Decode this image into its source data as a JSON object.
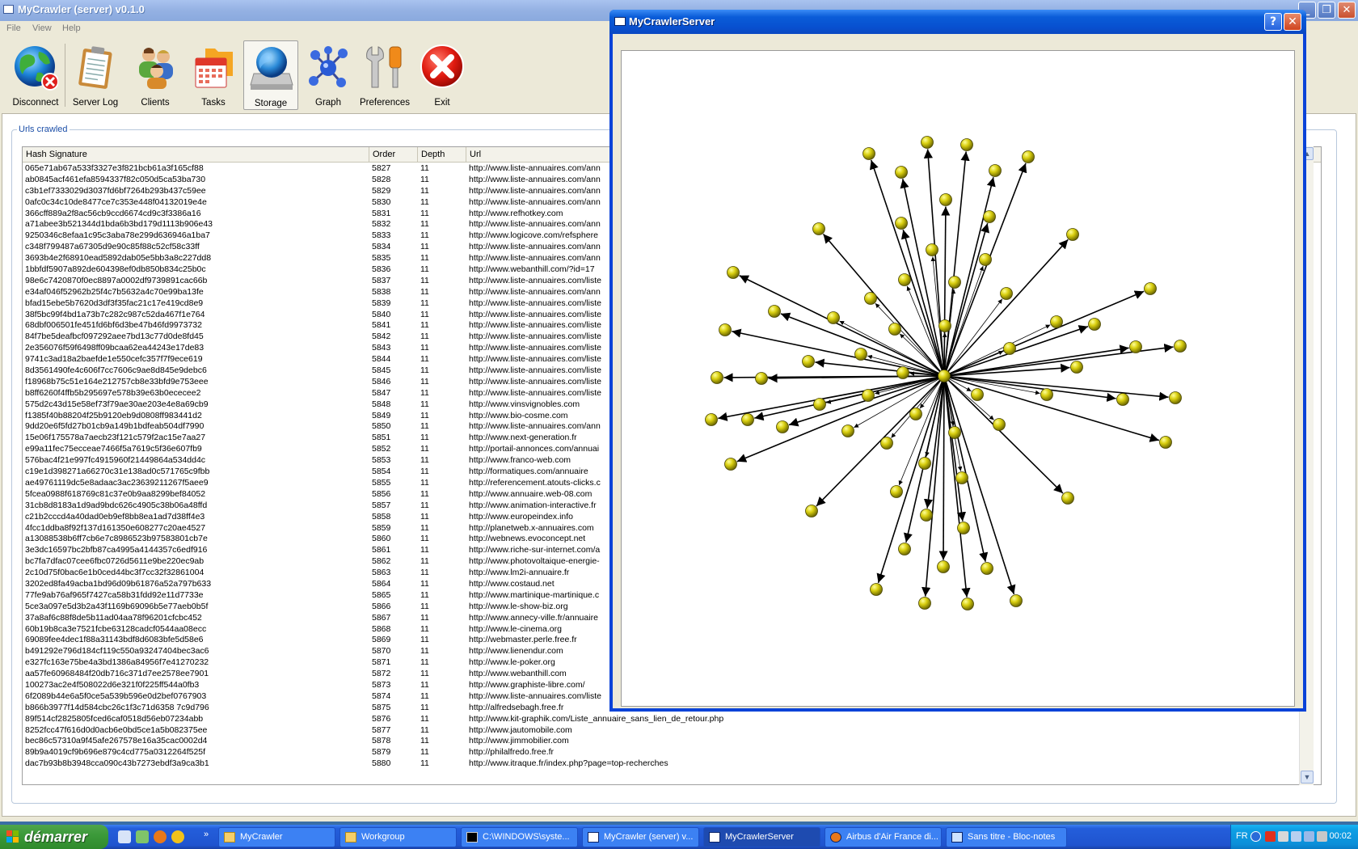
{
  "main_window": {
    "title": "MyCrawler (server) v0.1.0",
    "menu": [
      "File",
      "View",
      "Help"
    ],
    "toolbar": [
      {
        "label": "Disconnect",
        "icon": "globe-disconnect-icon"
      },
      {
        "label": "Server Log",
        "icon": "clipboard-icon"
      },
      {
        "label": "Clients",
        "icon": "users-icon"
      },
      {
        "label": "Tasks",
        "icon": "calendar-folder-icon"
      },
      {
        "label": "Storage",
        "icon": "storage-globe-icon",
        "active": true
      },
      {
        "label": "Graph",
        "icon": "molecule-graph-icon"
      },
      {
        "label": "Preferences",
        "icon": "wrench-icon"
      },
      {
        "label": "Exit",
        "icon": "exit-x-icon"
      }
    ],
    "group_title": "Urls crawled",
    "columns": [
      "Hash Signature",
      "Order",
      "Depth",
      "Url"
    ],
    "rows": [
      [
        "065e71ab67a533f3327e3f821bcb61a3f165cf88",
        "5827",
        "11",
        "http://www.liste-annuaires.com/ann"
      ],
      [
        "ab0845acf461efa8594337f82c050d5ca53ba730",
        "5828",
        "11",
        "http://www.liste-annuaires.com/ann"
      ],
      [
        "c3b1ef7333029d3037fd6bf7264b293b437c59ee",
        "5829",
        "11",
        "http://www.liste-annuaires.com/ann"
      ],
      [
        "0afc0c34c10de8477ce7c353e448f04132019e4e",
        "5830",
        "11",
        "http://www.liste-annuaires.com/ann"
      ],
      [
        "366cff889a2f8ac56cb9ccd6674cd9c3f3386a16",
        "5831",
        "11",
        "http://www.refhotkey.com"
      ],
      [
        "a71abee3b521344d1bda6b3bd179d1113b906e43",
        "5832",
        "11",
        "http://www.liste-annuaires.com/ann"
      ],
      [
        "9250346c8efaa1c95c3aba78e299d636946a1ba7",
        "5833",
        "11",
        "http://www.logicove.com/refsphere"
      ],
      [
        "c348f799487a67305d9e90c85f88c52cf58c33ff",
        "5834",
        "11",
        "http://www.liste-annuaires.com/ann"
      ],
      [
        "3693b4e2f68910ead5892dab05e5bb3a8c227dd8",
        "5835",
        "11",
        "http://www.liste-annuaires.com/ann"
      ],
      [
        "1bbfdf5907a892de604398ef0db850b834c25b0c",
        "5836",
        "11",
        "http://www.webanthill.com/?id=17"
      ],
      [
        "98e6c7420870f0ec8897a0002df9739891cac66b",
        "5837",
        "11",
        "http://www.liste-annuaires.com/liste"
      ],
      [
        "e34af046f52962b25f4c7b5632a4c70e99ba13fe",
        "5838",
        "11",
        "http://www.liste-annuaires.com/ann"
      ],
      [
        "bfad15ebe5b7620d3df3f35fac21c17e419cd8e9",
        "5839",
        "11",
        "http://www.liste-annuaires.com/liste"
      ],
      [
        "38f5bc99f4bd1a73b7c282c987c52da467f1e764",
        "5840",
        "11",
        "http://www.liste-annuaires.com/liste"
      ],
      [
        "68dbf006501fe451fd6bf6d3be47b46fd9973732",
        "5841",
        "11",
        "http://www.liste-annuaires.com/liste"
      ],
      [
        "84f7be5deafbcf097292aee7bd13c77d0de8fd45",
        "5842",
        "11",
        "http://www.liste-annuaires.com/liste"
      ],
      [
        "2e356076f59f6498ff09bcaa62ea44243e17de83",
        "5843",
        "11",
        "http://www.liste-annuaires.com/liste"
      ],
      [
        "9741c3ad18a2baefde1e550cefc357f7f9ece619",
        "5844",
        "11",
        "http://www.liste-annuaires.com/liste"
      ],
      [
        "8d3561490fe4c606f7cc7606c9ae8d845e9debc6",
        "5845",
        "11",
        "http://www.liste-annuaires.com/liste"
      ],
      [
        "f18968b75c51e164e212757cb8e33bfd9e753eee",
        "5846",
        "11",
        "http://www.liste-annuaires.com/liste"
      ],
      [
        "b8ff6260f4ffb5b295697e578b39e63b0ececee2",
        "5847",
        "11",
        "http://www.liste-annuaires.com/liste"
      ],
      [
        "575d2c43d15e58ef73f79ae30ae203e4e8a69cb9",
        "5848",
        "11",
        "http://www.vinsvignobles.com"
      ],
      [
        "f1385f40b88204f25b9120eb9d0808ff983441d2",
        "5849",
        "11",
        "http://www.bio-cosme.com"
      ],
      [
        "9dd20e6f5fd27b01cb9a149b1bdfeab504df7990",
        "5850",
        "11",
        "http://www.liste-annuaires.com/ann"
      ],
      [
        "15e06f175578a7aecb23f121c579f2ac15e7aa27",
        "5851",
        "11",
        "http://www.next-generation.fr"
      ],
      [
        "e99a11fec75ecceae7466f5a7619c5f36e607fb9",
        "5852",
        "11",
        "http://portail-annonces.com/annuai"
      ],
      [
        "576bac4f21e997fc4915960f21449864a534dd4c",
        "5853",
        "11",
        "http://www.franco-web.com"
      ],
      [
        "c19e1d398271a66270c31e138ad0c571765c9fbb",
        "5854",
        "11",
        "http://formatiques.com/annuaire"
      ],
      [
        "ae49761119dc5e8adaac3ac23639211267f5aee9",
        "5855",
        "11",
        "http://referencement.atouts-clicks.c"
      ],
      [
        "5fcea0988f618769c81c37e0b9aa8299bef84052",
        "5856",
        "11",
        "http://www.annuaire.web-08.com"
      ],
      [
        "31cb8d8183a1d9ad9bdc626c4905c38b06a48ffd",
        "5857",
        "11",
        "http://www.animation-interactive.fr"
      ],
      [
        "c21b2cccd4a40dad0eb9ef8bb8ea1ad7d38ff4e3",
        "5858",
        "11",
        "http://www.europeindex.info"
      ],
      [
        "4fcc1ddba8f92f137d161350e608277c20ae4527",
        "5859",
        "11",
        "http://planetweb.x-annuaires.com"
      ],
      [
        "a13088538b6ff7cb6e7c8986523b97583801cb7e",
        "5860",
        "11",
        "http://webnews.evoconcept.net"
      ],
      [
        "3e3dc16597bc2bfb87ca4995a4144357c6edf916",
        "5861",
        "11",
        "http://www.riche-sur-internet.com/a"
      ],
      [
        "bc7fa7dfac07cee6fbc0726d5611e9be220ec9ab",
        "5862",
        "11",
        "http://www.photovoltaique-energie-"
      ],
      [
        "2c10d75f0bac6e1b0ced44bc3f7cc32f32861004",
        "5863",
        "11",
        "http://www.lm2i-annuaire.fr"
      ],
      [
        "3202ed8fa49acba1bd96d09b61876a52a797b633",
        "5864",
        "11",
        "http://www.costaud.net"
      ],
      [
        "77fe9ab76af965f7427ca58b31fdd92e11d7733e",
        "5865",
        "11",
        "http://www.martinique-martinique.c"
      ],
      [
        "5ce3a097e5d3b2a43f1169b69096b5e77aeb0b5f",
        "5866",
        "11",
        "http://www.le-show-biz.org"
      ],
      [
        "37a8af6c88f8de5b11ad04aa78f96201cfcbc452",
        "5867",
        "11",
        "http://www.annecy-ville.fr/annuaire"
      ],
      [
        "60b19b8ca3e7521fcbe63128cadcf0544aa08ecc",
        "5868",
        "11",
        "http://www.le-cinema.org"
      ],
      [
        "69089fee4dec1f88a31143bdf8d6083bfe5d58e6",
        "5869",
        "11",
        "http://webmaster.perle.free.fr"
      ],
      [
        "b491292e796d184cf119c550a93247404bec3ac6",
        "5870",
        "11",
        "http://www.lienendur.com"
      ],
      [
        "e327fc163e75be4a3bd1386a84956f7e41270232",
        "5871",
        "11",
        "http://www.le-poker.org"
      ],
      [
        "aa57fe60968484f20db716c371d7ee2578ee7901",
        "5872",
        "11",
        "http://www.webanthill.com"
      ],
      [
        "100273ac2e4f508022d6e321f0f225ff544a0fb3",
        "5873",
        "11",
        "http://www.graphiste-libre.com/"
      ],
      [
        "6f2089b44e6a5f0ce5a539b596e0d2bef0767903",
        "5874",
        "11",
        "http://www.liste-annuaires.com/liste"
      ],
      [
        "b866b3977f14d584cbc26c1f3c71d6358 7c9d796",
        "5875",
        "11",
        "http://alfredsebagh.free.fr"
      ],
      [
        "89f514cf2825805fced6caf0518d56eb07234abb",
        "5876",
        "11",
        "http://www.kit-graphik.com/Liste_annuaire_sans_lien_de_retour.php"
      ],
      [
        "8252fcc47f616d0d0acb6e0bd5ce1a5b082375ee",
        "5877",
        "11",
        "http://www.jautomobile.com"
      ],
      [
        "bec86c57310a9f45afe267578e16a35cac0002d4",
        "5878",
        "11",
        "http://www.jimmobilier.com"
      ],
      [
        "89b9a4019cf9b696e879c4cd775a0312264f525f",
        "5879",
        "11",
        "http://philalfredo.free.fr"
      ],
      [
        "dac7b93b8b3948cca090c43b7273ebdf3a9ca3b1",
        "5880",
        "11",
        "http://www.itraque.fr/index.php?page=top-recherches"
      ]
    ]
  },
  "graph_window": {
    "title": "MyCrawlerServer",
    "help_label": "?",
    "node_color": "#d4cc00",
    "hub_color": "#e0d800"
  },
  "taskbar": {
    "start_label": "démarrer",
    "tasks": [
      {
        "label": "MyCrawler",
        "icon": "folder-icon"
      },
      {
        "label": "Workgroup",
        "icon": "folder-icon"
      },
      {
        "label": "C:\\WINDOWS\\syste...",
        "icon": "console-icon"
      },
      {
        "label": "MyCrawler (server) v...",
        "icon": "window-icon"
      },
      {
        "label": "MyCrawlerServer",
        "icon": "window-icon",
        "active": true
      },
      {
        "label": "Airbus d'Air France di...",
        "icon": "firefox-icon"
      },
      {
        "label": "Sans titre - Bloc-notes",
        "icon": "notepad-icon"
      }
    ],
    "language": "FR",
    "clock": "00:02"
  }
}
